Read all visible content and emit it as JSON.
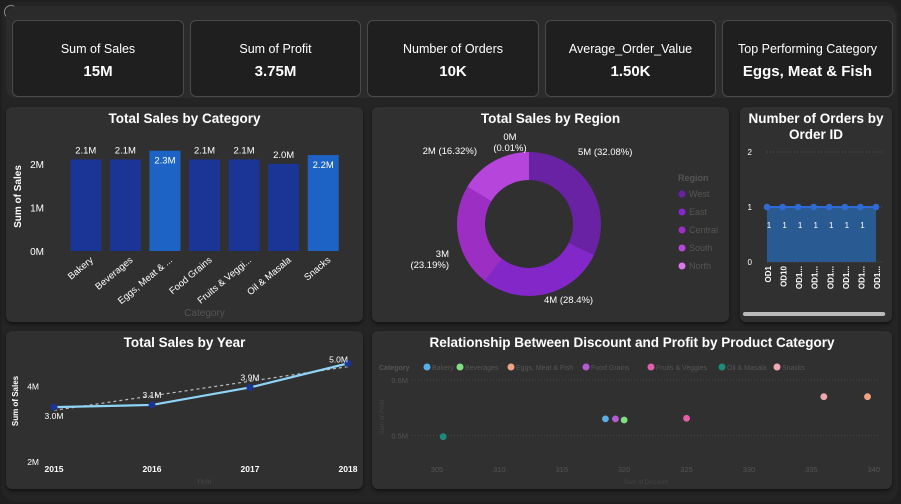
{
  "kpis": [
    {
      "title": "Sum of Sales",
      "value": "15M"
    },
    {
      "title": "Sum of Profit",
      "value": "3.75M"
    },
    {
      "title": "Number of Orders",
      "value": "10K"
    },
    {
      "title": "Average_Order_Value",
      "value": "1.50K"
    },
    {
      "title": "Top Performing Category",
      "value": "Eggs, Meat & Fish"
    }
  ],
  "chart_data": [
    {
      "type": "bar",
      "title": "Total Sales by Category",
      "xlabel": "Category",
      "ylabel": "Sum of Sales",
      "categories": [
        "Bakery",
        "Beverages",
        "Eggs, Meat & ...",
        "Food Grains",
        "Fruits & Veggi...",
        "Oil & Masala",
        "Snacks"
      ],
      "values": [
        2.1,
        2.1,
        2.3,
        2.1,
        2.1,
        2.0,
        2.2
      ],
      "data_labels": [
        "2.1M",
        "2.1M",
        "2.3M",
        "2.1M",
        "2.1M",
        "2.0M",
        "2.2M"
      ],
      "highlighted": [
        "Eggs, Meat & ...",
        "Snacks"
      ],
      "yticks": [
        "0M",
        "1M",
        "2M"
      ],
      "ylim": [
        0,
        2.5
      ],
      "unit": "M",
      "colors": {
        "bar": "#1b3597",
        "highlight": "#1d63c6"
      }
    },
    {
      "type": "pie",
      "title": "Total Sales by Region",
      "legend_title": "Region",
      "legend_position": "right",
      "categories": [
        "West",
        "East",
        "Central",
        "South",
        "North"
      ],
      "values": [
        32.08,
        28.4,
        23.19,
        16.32,
        0.01
      ],
      "data_labels": [
        "5M (32.08%)",
        "4M (28.4%)",
        "3M (23.19%)",
        "2M (16.32%)",
        "0M (0.01%)"
      ],
      "colors": [
        "#6a22a4",
        "#8427c9",
        "#9c2ec4",
        "#b545db",
        "#d77ae8"
      ]
    },
    {
      "type": "area",
      "title": "Number of Orders by Order ID",
      "categories": [
        "OD1",
        "OD10",
        "OD1...",
        "OD1...",
        "OD1...",
        "OD1...",
        "OD1...",
        "OD1..."
      ],
      "values": [
        1,
        1,
        1,
        1,
        1,
        1,
        1,
        1
      ],
      "data_labels": [
        "1",
        "1",
        "1",
        "1",
        "1",
        "1",
        "1"
      ],
      "yticks": [
        "0",
        "1",
        "2"
      ],
      "ylim": [
        0,
        2
      ],
      "colors": {
        "area": "#2a5a92",
        "line": "#2f6bd6"
      }
    },
    {
      "type": "line",
      "title": "Total Sales by Year",
      "xlabel": "Year",
      "ylabel": "Sum of Sales",
      "x": [
        "2015",
        "2016",
        "2017",
        "2018"
      ],
      "values": [
        3.0,
        3.1,
        3.9,
        5.0
      ],
      "data_labels": [
        "3.0M",
        "3.1M",
        "3.9M",
        "5.0M"
      ],
      "trendline": true,
      "yticks": [
        "2M",
        "4M"
      ],
      "ylim": [
        2,
        5.2
      ],
      "colors": {
        "line": "#8fd3f5",
        "marker": "#1b3597"
      }
    },
    {
      "type": "scatter",
      "title": "Relationship Between Discount and Profit by Product Category",
      "xlabel": "Sum of Discount",
      "ylabel": "Sum of Profit",
      "legend_title": "Category",
      "legend_position": "top-left",
      "series": [
        {
          "name": "Bakery",
          "color": "#5aaee8",
          "points": [
            [
              318.5,
              0.53
            ]
          ]
        },
        {
          "name": "Beverages",
          "color": "#7ee07e",
          "points": [
            [
              320,
              0.528
            ]
          ]
        },
        {
          "name": "Eggs, Meat & Fish",
          "color": "#f0a282",
          "points": [
            [
              339.5,
              0.57
            ]
          ]
        },
        {
          "name": "Food Grains",
          "color": "#b65ad6",
          "points": [
            [
              319.3,
              0.53
            ]
          ]
        },
        {
          "name": "Fruits & Veggies",
          "color": "#e05fa8",
          "points": [
            [
              325,
              0.531
            ]
          ]
        },
        {
          "name": "Oil & Masala",
          "color": "#1d8a7a",
          "points": [
            [
              305.5,
              0.498
            ]
          ]
        },
        {
          "name": "Snacks",
          "color": "#f0a8b0",
          "points": [
            [
              336,
              0.57
            ]
          ]
        }
      ],
      "xticks": [
        "305",
        "310",
        "315",
        "320",
        "325",
        "330",
        "335",
        "340"
      ],
      "yticks": [
        "0.5M",
        "0.6M"
      ],
      "xlim": [
        303,
        340.5
      ],
      "ylim": [
        0.465,
        0.6
      ]
    }
  ]
}
